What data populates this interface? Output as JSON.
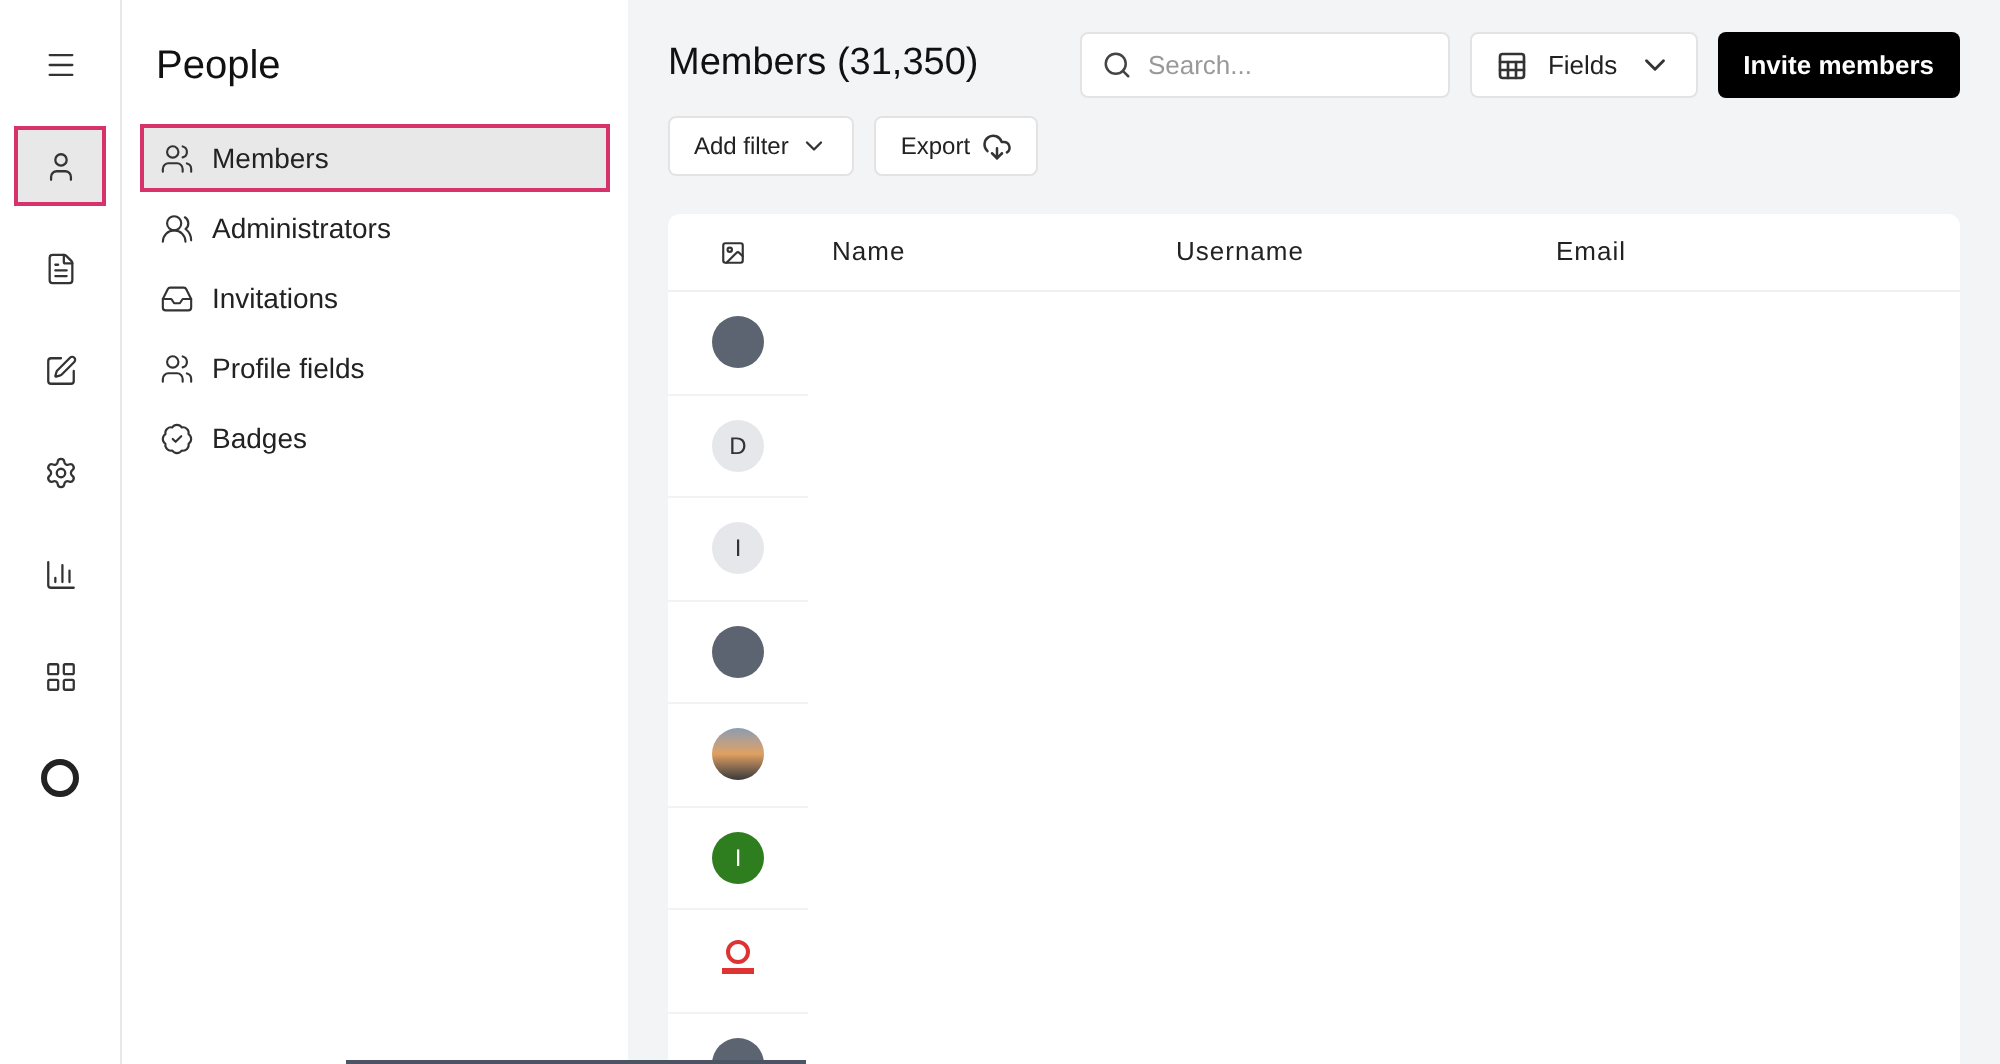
{
  "rail": [
    {
      "kind": "menu",
      "selected": false
    },
    {
      "kind": "person",
      "selected": true
    },
    {
      "kind": "document",
      "selected": false
    },
    {
      "kind": "edit",
      "selected": false
    },
    {
      "kind": "settings",
      "selected": false
    },
    {
      "kind": "chart",
      "selected": false
    },
    {
      "kind": "grid",
      "selected": false
    },
    {
      "kind": "ring",
      "selected": false
    }
  ],
  "sidebar": {
    "title": "People",
    "items": [
      {
        "label": "Members",
        "kind": "group",
        "selected": true
      },
      {
        "label": "Administrators",
        "kind": "pair",
        "selected": false
      },
      {
        "label": "Invitations",
        "kind": "inbox",
        "selected": false
      },
      {
        "label": "Profile fields",
        "kind": "group",
        "selected": false
      },
      {
        "label": "Badges",
        "kind": "badge",
        "selected": false
      }
    ]
  },
  "header": {
    "title": "Members (31,350)",
    "search": {
      "placeholder": "Search..."
    },
    "fields_button": "Fields",
    "invite_button": "Invite members",
    "filter_button": "Add filter",
    "export_button": "Export"
  },
  "table": {
    "columns": [
      "Name",
      "Username",
      "Email"
    ],
    "rows": [
      {
        "kind": "photo"
      },
      {
        "kind": "initial",
        "letter": "D",
        "color": "#e5e7eb"
      },
      {
        "kind": "initial",
        "letter": "I",
        "color": "#e5e7eb"
      },
      {
        "kind": "photo"
      },
      {
        "kind": "landscape"
      },
      {
        "kind": "initial",
        "letter": "I",
        "color": "#2e7d1f"
      },
      {
        "kind": "logo"
      },
      {
        "kind": "photo"
      }
    ]
  }
}
